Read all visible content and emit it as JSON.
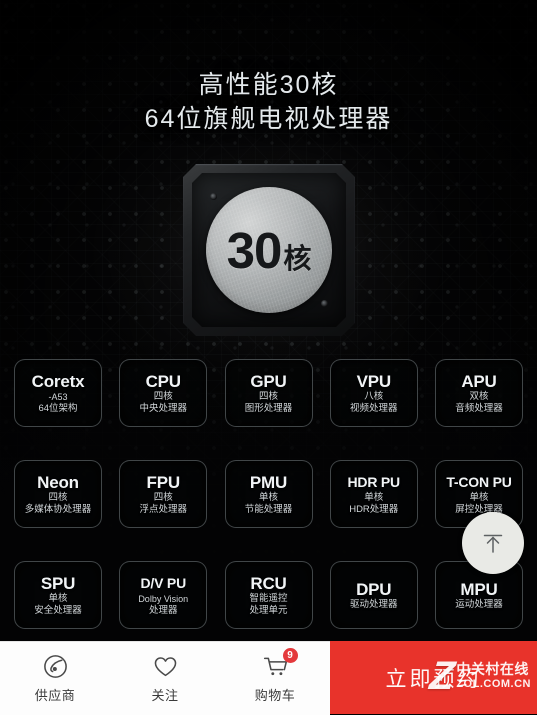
{
  "poster": {
    "headline": {
      "line1": "高性能30核",
      "line2": "64位旗舰电视处理器"
    },
    "chip": {
      "core_count": "30",
      "core_unit": "核"
    },
    "modules": [
      [
        {
          "title": "Coretx",
          "sub1": "-A53",
          "sub2": "64位架构",
          "latin_sub1": true
        },
        {
          "title": "CPU",
          "sub1": "四核",
          "sub2": "中央处理器"
        },
        {
          "title": "GPU",
          "sub1": "四核",
          "sub2": "图形处理器"
        },
        {
          "title": "VPU",
          "sub1": "八核",
          "sub2": "视频处理器"
        },
        {
          "title": "APU",
          "sub1": "双核",
          "sub2": "音频处理器"
        }
      ],
      [
        {
          "title": "Neon",
          "sub1": "四核",
          "sub2": "多媒体协处理器"
        },
        {
          "title": "FPU",
          "sub1": "四核",
          "sub2": "浮点处理器"
        },
        {
          "title": "PMU",
          "sub1": "单核",
          "sub2": "节能处理器"
        },
        {
          "title": "HDR PU",
          "sub1": "单核",
          "sub2": "HDR处理器",
          "small_title": true
        },
        {
          "title": "T-CON PU",
          "sub1": "单核",
          "sub2": "屏控处理器",
          "small_title": true
        }
      ],
      [
        {
          "title": "SPU",
          "sub1": "单核",
          "sub2": "安全处理器"
        },
        {
          "title": "D/V PU",
          "sub1": "Dolby Vision",
          "sub2": "处理器",
          "small_title": true,
          "latin_sub1": true
        },
        {
          "title": "RCU",
          "sub1": "智能遥控",
          "sub2": "处理单元"
        },
        {
          "title": "DPU",
          "sub1": "",
          "sub2": "驱动处理器"
        },
        {
          "title": "MPU",
          "sub1": "",
          "sub2": "运动处理器"
        }
      ]
    ]
  },
  "scroll_top": {
    "icon": "arrow-up-to-line-icon"
  },
  "bottom_nav": {
    "items": [
      {
        "label": "供应商",
        "icon": "supplier-icon",
        "badge": ""
      },
      {
        "label": "关注",
        "icon": "heart-icon",
        "badge": ""
      },
      {
        "label": "购物车",
        "icon": "cart-icon",
        "badge": "9"
      }
    ]
  },
  "cta": {
    "label": "立即预约",
    "color": "#e8332b"
  },
  "watermark": {
    "logo": "Z",
    "cn": "中关村在线",
    "en": "ZOL.COM.CN"
  }
}
